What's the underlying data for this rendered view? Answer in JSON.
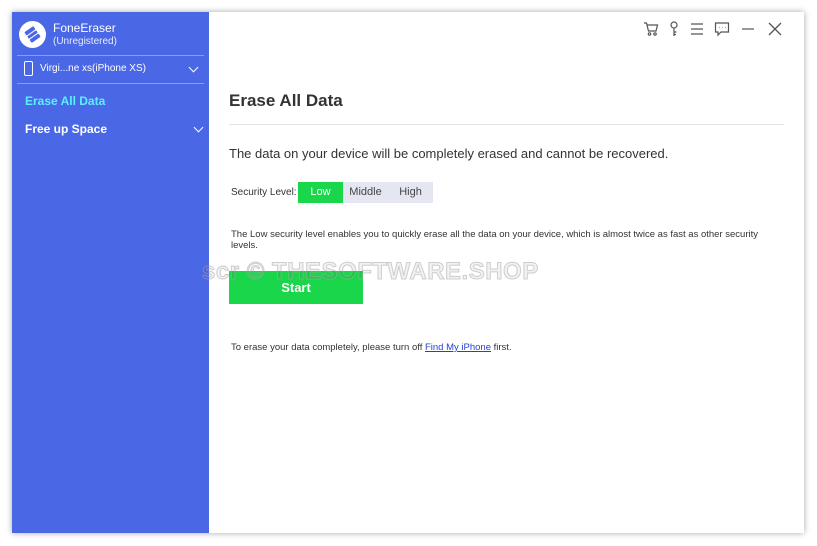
{
  "app": {
    "name": "FoneEraser",
    "registration": "(Unregistered)"
  },
  "device": {
    "label": "Virgi...ne xs(iPhone XS)"
  },
  "sidebar": {
    "items": [
      {
        "label": "Erase All Data"
      },
      {
        "label": "Free up Space"
      }
    ]
  },
  "window_controls": [
    "cart-icon",
    "key-icon",
    "menu-icon",
    "chat-icon",
    "minimize-icon",
    "close-icon"
  ],
  "main": {
    "title": "Erase All Data",
    "warning": "The data on your device will be completely erased and cannot be recovered.",
    "security": {
      "label": "Security Level:",
      "options": [
        "Low",
        "Middle",
        "High"
      ],
      "selected": "Low"
    },
    "description": "The Low security level enables you to quickly erase all the data on your device, which is almost twice as fast as other security levels.",
    "start_label": "Start",
    "footnote": {
      "before": "To erase your data completely, please turn off ",
      "link": "Find My iPhone",
      "after": " first."
    }
  },
  "watermark": "scr © THESOFTWARE.SHOP",
  "colors": {
    "sidebar": "#4a67e6",
    "accent_text": "#5cf0ff",
    "green": "#19d64a"
  }
}
